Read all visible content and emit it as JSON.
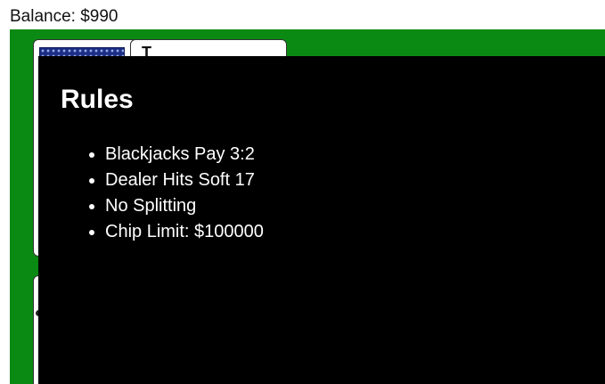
{
  "balance": {
    "label": "Balance: $990"
  },
  "table": {
    "felt_color": "#0b8a13",
    "face_card_rank": "T"
  },
  "modal": {
    "title": "Rules",
    "rules": [
      "Blackjacks Pay 3:2",
      "Dealer Hits Soft 17",
      "No Splitting",
      "Chip Limit: $100000"
    ]
  }
}
